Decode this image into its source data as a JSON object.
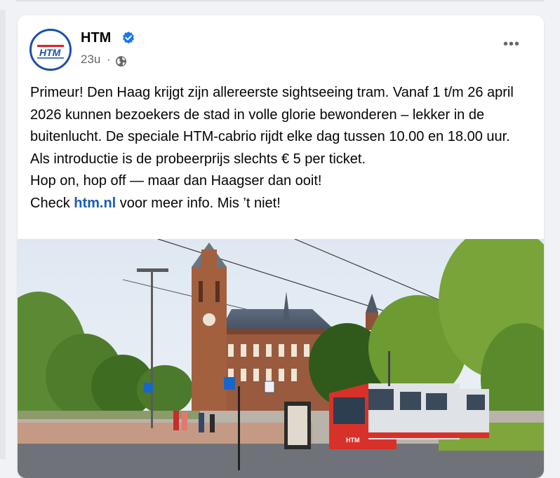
{
  "post": {
    "author": "HTM",
    "verified": true,
    "time": "23u",
    "visibility_icon": "globe-icon",
    "more_icon": "more-horizontal-icon",
    "more_label": "•••",
    "logo_text": "HTM",
    "text": {
      "line1": "Primeur! Den Haag krijgt zijn allereerste sightseeing tram. Vanaf 1 t/m 26 april 2026 kunnen bezoekers de stad in volle glorie bewonderen – lekker in de buitenlucht. De speciale HTM-cabrio rijdt elke dag tussen 10.00 en 18.00 uur.",
      "line2": "Als introductie is de probeerprijs slechts € 5 per ticket.",
      "line3": "Hop on, hop off — maar dan Haagser dan ooit!",
      "line4_before": "Check ",
      "link": "htm.nl",
      "line4_after": " voor meer info.  Mis ’t niet!"
    }
  },
  "colors": {
    "accent": "#1b5bb8",
    "verified": "#1877f2",
    "logo_blue": "#1d4fae",
    "logo_red": "#e41e26",
    "tram_red": "#d8312a"
  }
}
